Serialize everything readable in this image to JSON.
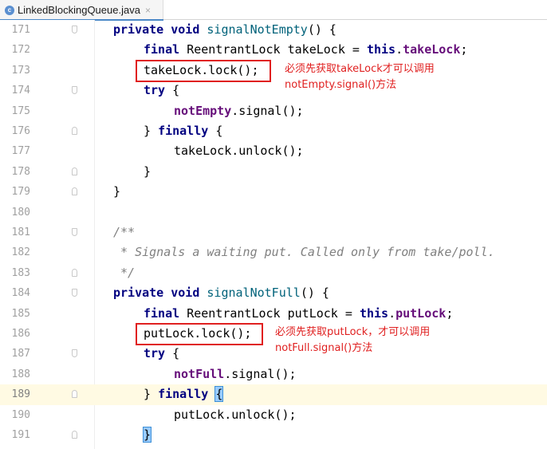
{
  "tab": {
    "icon_letter": "c",
    "filename": "LinkedBlockingQueue.java",
    "close_symbol": "×"
  },
  "lines": [
    {
      "n": "171",
      "fold": "down",
      "tokens": [
        {
          "t": "kw",
          "v": "private void "
        },
        {
          "t": "fn",
          "v": "signalNotEmpty"
        },
        {
          "t": "",
          "v": "() {"
        }
      ]
    },
    {
      "n": "172",
      "fold": "",
      "tokens": [
        {
          "t": "kw",
          "v": "final "
        },
        {
          "t": "",
          "v": "ReentrantLock takeLock = "
        },
        {
          "t": "kw",
          "v": "this"
        },
        {
          "t": "",
          "v": "."
        },
        {
          "t": "field",
          "v": "takeLock"
        },
        {
          "t": "",
          "v": ";"
        }
      ]
    },
    {
      "n": "173",
      "fold": "",
      "tokens": [
        {
          "t": "",
          "v": "takeLock.lock();"
        }
      ]
    },
    {
      "n": "174",
      "fold": "down",
      "tokens": [
        {
          "t": "kw",
          "v": "try "
        },
        {
          "t": "",
          "v": "{"
        }
      ]
    },
    {
      "n": "175",
      "fold": "",
      "tokens": [
        {
          "t": "field",
          "v": "notEmpty"
        },
        {
          "t": "",
          "v": ".signal();"
        }
      ]
    },
    {
      "n": "176",
      "fold": "up",
      "tokens": [
        {
          "t": "",
          "v": "} "
        },
        {
          "t": "kw",
          "v": "finally "
        },
        {
          "t": "",
          "v": "{"
        }
      ]
    },
    {
      "n": "177",
      "fold": "",
      "tokens": [
        {
          "t": "",
          "v": "takeLock.unlock();"
        }
      ]
    },
    {
      "n": "178",
      "fold": "up",
      "tokens": [
        {
          "t": "",
          "v": "}"
        }
      ]
    },
    {
      "n": "179",
      "fold": "up",
      "tokens": [
        {
          "t": "",
          "v": "}"
        }
      ]
    },
    {
      "n": "180",
      "fold": "",
      "tokens": []
    },
    {
      "n": "181",
      "fold": "down",
      "tokens": [
        {
          "t": "comment",
          "v": "/**"
        }
      ]
    },
    {
      "n": "182",
      "fold": "",
      "tokens": [
        {
          "t": "comment",
          "v": " * Signals a waiting put. Called only from take/poll."
        }
      ]
    },
    {
      "n": "183",
      "fold": "up",
      "tokens": [
        {
          "t": "comment",
          "v": " */"
        }
      ]
    },
    {
      "n": "184",
      "fold": "down",
      "tokens": [
        {
          "t": "kw",
          "v": "private void "
        },
        {
          "t": "fn",
          "v": "signalNotFull"
        },
        {
          "t": "",
          "v": "() {"
        }
      ]
    },
    {
      "n": "185",
      "fold": "",
      "tokens": [
        {
          "t": "kw",
          "v": "final "
        },
        {
          "t": "",
          "v": "ReentrantLock putLock = "
        },
        {
          "t": "kw",
          "v": "this"
        },
        {
          "t": "",
          "v": "."
        },
        {
          "t": "field",
          "v": "putLock"
        },
        {
          "t": "",
          "v": ";"
        }
      ]
    },
    {
      "n": "186",
      "fold": "",
      "tokens": [
        {
          "t": "",
          "v": "putLock.lock();"
        }
      ]
    },
    {
      "n": "187",
      "fold": "down",
      "tokens": [
        {
          "t": "kw",
          "v": "try "
        },
        {
          "t": "",
          "v": "{"
        }
      ]
    },
    {
      "n": "188",
      "fold": "",
      "tokens": [
        {
          "t": "field",
          "v": "notFull"
        },
        {
          "t": "",
          "v": ".signal();"
        }
      ]
    },
    {
      "n": "189",
      "fold": "up",
      "current": true,
      "tokens": [
        {
          "t": "",
          "v": "} "
        },
        {
          "t": "kw",
          "v": "finally "
        },
        {
          "t": "brace",
          "v": "{"
        }
      ]
    },
    {
      "n": "190",
      "fold": "",
      "tokens": [
        {
          "t": "",
          "v": "putLock.unlock();"
        }
      ]
    },
    {
      "n": "191",
      "fold": "up",
      "tokens": [
        {
          "t": "brace",
          "v": "}"
        }
      ]
    }
  ],
  "annotations": {
    "take_note_line1": "必须先获取takeLock才可以调用",
    "take_note_line2": "notEmpty.signal()方法",
    "put_note_line1": "必须先获取putLock，才可以调用",
    "put_note_line2": "notFull.signal()方法"
  },
  "colors": {
    "keyword": "#000080",
    "field": "#660e7a",
    "comment": "#808080",
    "annotation_red": "#e02020",
    "current_line": "#fffae3"
  }
}
